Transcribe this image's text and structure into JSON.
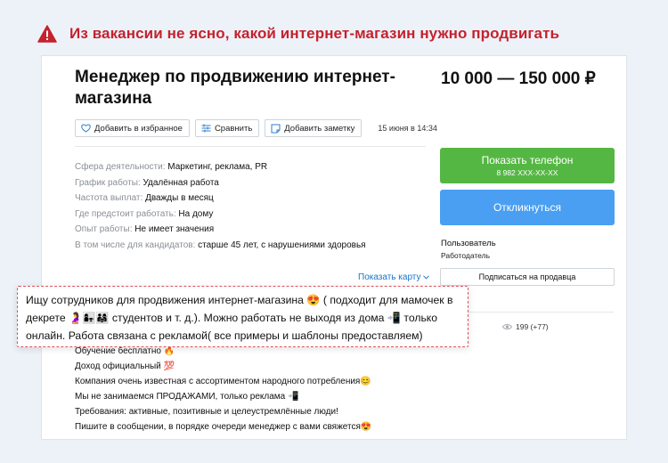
{
  "warning": {
    "text": "Из вакансии не ясно, какой интернет-магазин нужно продвигать"
  },
  "listing": {
    "title": "Менеджер по продвижению интернет-магазина",
    "price": "10 000 — 150 000 ₽",
    "actions": {
      "favorite_label": "Добавить в избранное",
      "compare_label": "Сравнить",
      "note_label": "Добавить заметку"
    },
    "date": "15 июня в 14:34",
    "params": [
      {
        "label": "Сфера деятельности:",
        "value": "Маркетинг, реклама, PR"
      },
      {
        "label": "График работы:",
        "value": "Удалённая работа"
      },
      {
        "label": "Частота выплат:",
        "value": "Дважды в месяц"
      },
      {
        "label": "Где предстоит работать:",
        "value": "На дому"
      },
      {
        "label": "Опыт работы:",
        "value": "Не имеет значения"
      },
      {
        "label": "В том числе для кандидатов:",
        "value": "старше 45 лет, с нарушениями здоровья"
      }
    ],
    "show_map_label": "Показать карту",
    "views": "199 (+77)",
    "description": [
      "Обучение бесплатно 🔥",
      "Доход официальный 💯",
      "Компания очень известная с ассортиментом народного потребления😊",
      "Мы не занимаемся ПРОДАЖАМИ, только реклама 📲",
      "Требования: активные, позитивные и целеустремлённые люди!",
      "Пишите в сообщении, в порядке очереди менеджер с вами свяжется😍"
    ]
  },
  "sidebar": {
    "phone_button_label": "Показать телефон",
    "phone_masked": "8 982 XXX-XX-XX",
    "respond_button_label": "Откликнуться",
    "user_name": "Пользователь",
    "user_role": "Работодатель",
    "subscribe_label": "Подписаться на продавца"
  },
  "highlight": {
    "lines": [
      "Ищу сотрудников для продвижения интернет-магазина 😍 ( подходит для мамочек в",
      "декрете 🤰👩‍👧👨‍👩‍👧 студентов и т. д.). Можно работать не выходя из дома 📲 только",
      "онлайн. Работа связана с рекламой( все примеры и шаблоны предоставляем)"
    ]
  },
  "colors": {
    "warning_red": "#c4222e",
    "phone_green": "#55b743",
    "respond_blue": "#4a9ff2",
    "link_blue": "#1a73c8",
    "highlight_border": "#d9545f"
  }
}
